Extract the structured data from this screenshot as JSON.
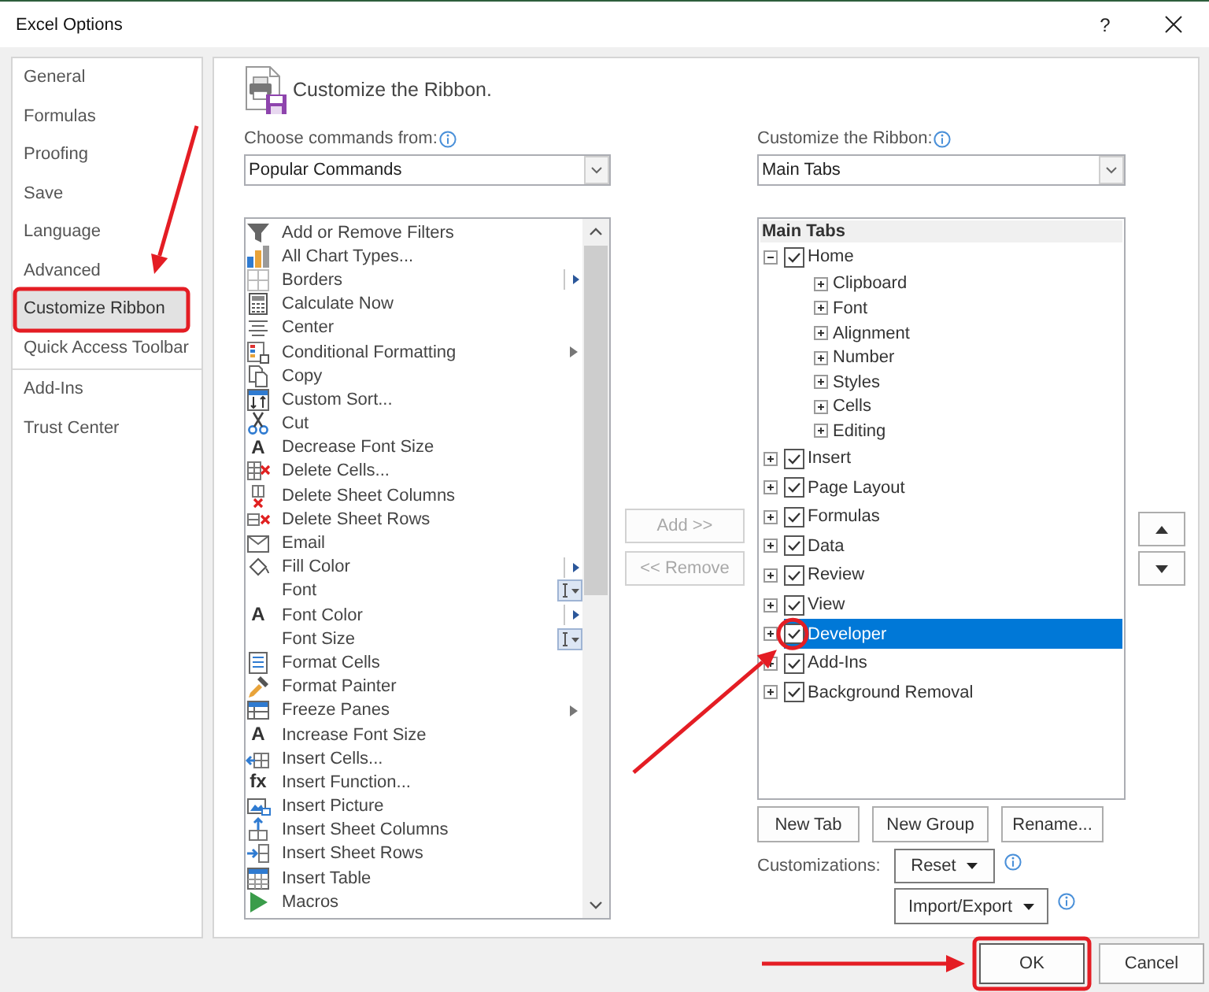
{
  "window": {
    "title": "Excel Options",
    "help_button": "?"
  },
  "sidebar": {
    "sections": [
      {
        "items": [
          {
            "label": "General",
            "selected": false,
            "callout": false
          },
          {
            "label": "Formulas",
            "selected": false,
            "callout": false
          },
          {
            "label": "Proofing",
            "selected": false,
            "callout": false
          },
          {
            "label": "Save",
            "selected": false,
            "callout": false
          },
          {
            "label": "Language",
            "selected": false,
            "callout": false
          },
          {
            "label": "Advanced",
            "selected": false,
            "callout": false
          },
          {
            "label": "Customize Ribbon",
            "selected": true,
            "callout": true
          },
          {
            "label": "Quick Access Toolbar",
            "selected": false,
            "callout": false
          }
        ]
      },
      {
        "items": [
          {
            "label": "Add-Ins",
            "selected": false,
            "callout": false
          },
          {
            "label": "Trust Center",
            "selected": false,
            "callout": false
          }
        ]
      }
    ]
  },
  "header": {
    "title": "Customize the Ribbon."
  },
  "commands_source": {
    "label": "Choose commands from:",
    "info": true,
    "value": "Popular Commands"
  },
  "commands": [
    {
      "label": "Add or Remove Filters",
      "kind": "button"
    },
    {
      "label": "All Chart Types...",
      "kind": "button"
    },
    {
      "label": "Borders",
      "kind": "split"
    },
    {
      "label": "Calculate Now",
      "kind": "button"
    },
    {
      "label": "Center",
      "kind": "button"
    },
    {
      "label": "Conditional Formatting",
      "kind": "menu"
    },
    {
      "label": "Copy",
      "kind": "button"
    },
    {
      "label": "Custom Sort...",
      "kind": "button"
    },
    {
      "label": "Cut",
      "kind": "button"
    },
    {
      "label": "Decrease Font Size",
      "kind": "button",
      "glyph": "A"
    },
    {
      "label": "Delete Cells...",
      "kind": "button"
    },
    {
      "label": "Delete Sheet Columns",
      "kind": "button"
    },
    {
      "label": "Delete Sheet Rows",
      "kind": "button"
    },
    {
      "label": "Email",
      "kind": "button"
    },
    {
      "label": "Fill Color",
      "kind": "split"
    },
    {
      "label": "Font",
      "kind": "combo"
    },
    {
      "label": "Font Color",
      "kind": "split",
      "glyph": "A"
    },
    {
      "label": "Font Size",
      "kind": "combo"
    },
    {
      "label": "Format Cells",
      "kind": "button"
    },
    {
      "label": "Format Painter",
      "kind": "button"
    },
    {
      "label": "Freeze Panes",
      "kind": "menu"
    },
    {
      "label": "Increase Font Size",
      "kind": "button",
      "glyph": "A"
    },
    {
      "label": "Insert Cells...",
      "kind": "button"
    },
    {
      "label": "Insert Function...",
      "kind": "button",
      "glyph": "fx"
    },
    {
      "label": "Insert Picture",
      "kind": "button"
    },
    {
      "label": "Insert Sheet Columns",
      "kind": "button"
    },
    {
      "label": "Insert Sheet Rows",
      "kind": "button"
    },
    {
      "label": "Insert Table",
      "kind": "button"
    },
    {
      "label": "Macros",
      "kind": "button"
    }
  ],
  "transfer_buttons": [
    {
      "label": "Add >>",
      "disabled": true
    },
    {
      "label": "<< Remove",
      "disabled": true
    }
  ],
  "ribbon_target": {
    "label": "Customize the Ribbon:",
    "info": true,
    "value": "Main Tabs"
  },
  "tree": {
    "header": "Main Tabs",
    "items": [
      {
        "kind": "tab",
        "label": "Home",
        "expanded": true,
        "checked": true,
        "selected": false,
        "callout": false,
        "children": [
          {
            "kind": "group",
            "label": "Clipboard",
            "expanded": false,
            "selected": false,
            "callout": false
          },
          {
            "kind": "group",
            "label": "Font",
            "expanded": false,
            "selected": false,
            "callout": false
          },
          {
            "kind": "group",
            "label": "Alignment",
            "expanded": false,
            "selected": false,
            "callout": false
          },
          {
            "kind": "group",
            "label": "Number",
            "expanded": false,
            "selected": false,
            "callout": false
          },
          {
            "kind": "group",
            "label": "Styles",
            "expanded": false,
            "selected": false,
            "callout": false
          },
          {
            "kind": "group",
            "label": "Cells",
            "expanded": false,
            "selected": false,
            "callout": false
          },
          {
            "kind": "group",
            "label": "Editing",
            "expanded": false,
            "selected": false,
            "callout": false
          }
        ]
      },
      {
        "kind": "tab",
        "label": "Insert",
        "expanded": false,
        "checked": true,
        "selected": false,
        "callout": false
      },
      {
        "kind": "tab",
        "label": "Page Layout",
        "expanded": false,
        "checked": true,
        "selected": false,
        "callout": false
      },
      {
        "kind": "tab",
        "label": "Formulas",
        "expanded": false,
        "checked": true,
        "selected": false,
        "callout": false
      },
      {
        "kind": "tab",
        "label": "Data",
        "expanded": false,
        "checked": true,
        "selected": false,
        "callout": false
      },
      {
        "kind": "tab",
        "label": "Review",
        "expanded": false,
        "checked": true,
        "selected": false,
        "callout": false
      },
      {
        "kind": "tab",
        "label": "View",
        "expanded": false,
        "checked": true,
        "selected": false,
        "callout": false
      },
      {
        "kind": "tab",
        "label": "Developer",
        "expanded": false,
        "checked": true,
        "selected": true,
        "callout": true
      },
      {
        "kind": "tab",
        "label": "Add-Ins",
        "expanded": false,
        "checked": true,
        "selected": false,
        "callout": false
      },
      {
        "kind": "tab",
        "label": "Background Removal",
        "expanded": false,
        "checked": true,
        "selected": false,
        "callout": false
      }
    ]
  },
  "order_buttons": [
    {
      "kind": "up",
      "disabled": false
    },
    {
      "kind": "down",
      "disabled": false
    }
  ],
  "tree_buttons": [
    {
      "label": "New Tab",
      "disabled": false
    },
    {
      "label": "New Group",
      "disabled": false
    },
    {
      "label": "Rename...",
      "disabled": false
    }
  ],
  "customizations": {
    "label": "Customizations:",
    "buttons": [
      {
        "label": "Reset",
        "info": true
      },
      {
        "label": "Import/Export",
        "info": true
      }
    ]
  },
  "dialog_buttons": [
    {
      "label": "OK",
      "default": true,
      "callout": true
    },
    {
      "label": "Cancel",
      "default": false,
      "callout": false
    }
  ]
}
